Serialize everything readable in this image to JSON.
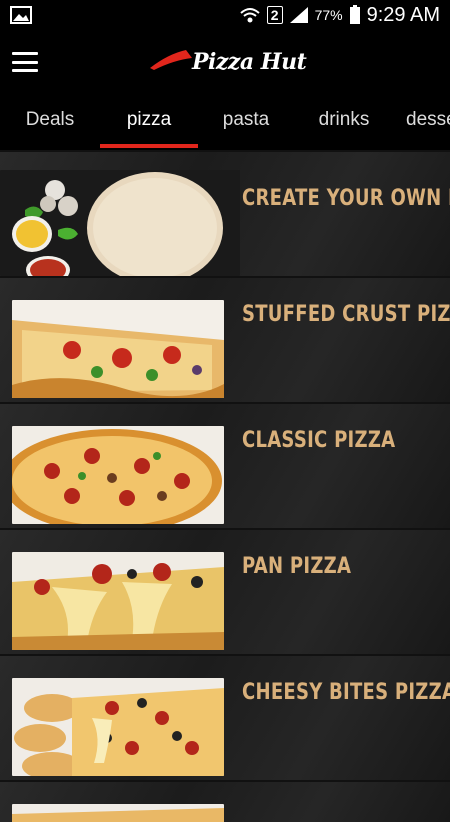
{
  "status_bar": {
    "battery": "77%",
    "sim": "2",
    "time": "9:29 AM"
  },
  "app_bar": {
    "logo_text": "Pizza Hut"
  },
  "tabs": [
    {
      "label": "Deals"
    },
    {
      "label": "pizza"
    },
    {
      "label": "pasta"
    },
    {
      "label": "drinks"
    },
    {
      "label": "desse"
    }
  ],
  "menu_items": [
    {
      "label": "CREATE YOUR OWN PIZ.."
    },
    {
      "label": "STUFFED CRUST PIZZA"
    },
    {
      "label": "CLASSIC PIZZA"
    },
    {
      "label": "PAN PIZZA"
    },
    {
      "label": "CHEESY BITES PIZZA"
    }
  ],
  "colors": {
    "accent": "#e1261c",
    "item_text": "#d9b07b"
  }
}
